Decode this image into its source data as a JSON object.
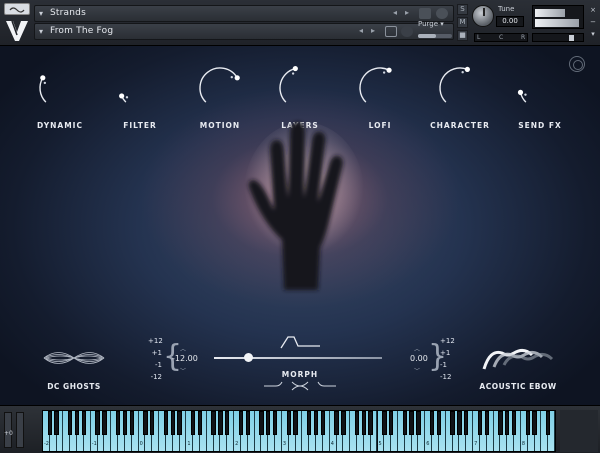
{
  "header": {
    "slot1_name": "Strands",
    "slot2_name": "From The Fog",
    "nav_prev": "◂",
    "nav_next": "▸",
    "purge_label": "Purge ▾",
    "tune_label": "Tune",
    "tune_value": "0.00",
    "lr_left": "L",
    "lr_mid": "C",
    "lr_right": "R",
    "side_buttons": [
      "S",
      "M",
      "■"
    ],
    "close_buttons": [
      "×",
      "−",
      "▾",
      "aux",
      "pv"
    ]
  },
  "knobs": [
    {
      "label": "DYNAMIC",
      "level": 0.28
    },
    {
      "label": "FILTER",
      "level": 0.08
    },
    {
      "label": "MOTION",
      "level": 0.72
    },
    {
      "label": "LAYERS",
      "level": 0.45
    },
    {
      "label": "LOFI",
      "level": 0.6
    },
    {
      "label": "CHARACTER",
      "level": 0.58
    },
    {
      "label": "SEND FX",
      "level": 0.12
    }
  ],
  "sources": {
    "left_name": "DC GHOSTS",
    "right_name": "ACOUSTIC EBOW"
  },
  "pitch_left": {
    "semitones": [
      "+12",
      "+1",
      "-1",
      "-12"
    ],
    "value": "-12.00",
    "up": "︿",
    "down": "﹀"
  },
  "pitch_right": {
    "semitones": [
      "+12",
      "+1",
      "-1",
      "-12"
    ],
    "value": "0.00",
    "up": "︿",
    "down": "﹀"
  },
  "morph": {
    "label": "MORPH",
    "position": 0.2
  },
  "keyboard": {
    "octave_offset": "+0",
    "octave_labels": [
      "-2",
      "-1",
      "0",
      "1",
      "2",
      "3",
      "4",
      "5",
      "6",
      "7",
      "8"
    ]
  },
  "colors": {
    "accent": "#e8ebf1",
    "keys": "#8fd6ea",
    "glow": "#d67880"
  }
}
